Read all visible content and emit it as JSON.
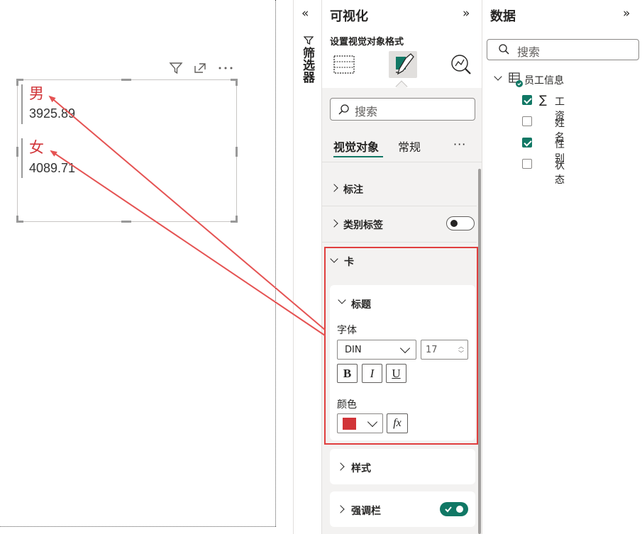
{
  "canvas": {
    "card": {
      "items": [
        {
          "category": "男",
          "value": "3925.89"
        },
        {
          "category": "女",
          "value": "4089.71"
        }
      ],
      "category_color": "#d13438"
    }
  },
  "filters": {
    "label": "筛选器"
  },
  "visualizations": {
    "title": "可视化",
    "subtitle": "设置视觉对象格式",
    "search_placeholder": "搜索",
    "tabs": [
      "视觉对象",
      "常规"
    ],
    "sections": {
      "callout": "标注",
      "category_label": "类别标签",
      "card": "卡",
      "title": "标题",
      "font_label": "字体",
      "font_family": "DIN",
      "font_size": "17",
      "bold": "B",
      "italic": "I",
      "underline": "U",
      "color_label": "颜色",
      "color_value": "#d13438",
      "fx": "fx",
      "style": "样式",
      "accent_bar": "强调栏"
    },
    "category_label_toggle": "off",
    "accent_bar_toggle": "on"
  },
  "data_pane": {
    "title": "数据",
    "search_placeholder": "搜索",
    "table": "员工信息",
    "fields": [
      {
        "label": "工资",
        "checked": true,
        "sigma": true
      },
      {
        "label": "姓名",
        "checked": false,
        "sigma": false
      },
      {
        "label": "性别",
        "checked": true,
        "sigma": false
      },
      {
        "label": "状态",
        "checked": false,
        "sigma": false
      }
    ]
  },
  "colors": {
    "accent": "#117865",
    "highlight_box": "#e03e3e",
    "annotation_arrow": "#e55353"
  }
}
